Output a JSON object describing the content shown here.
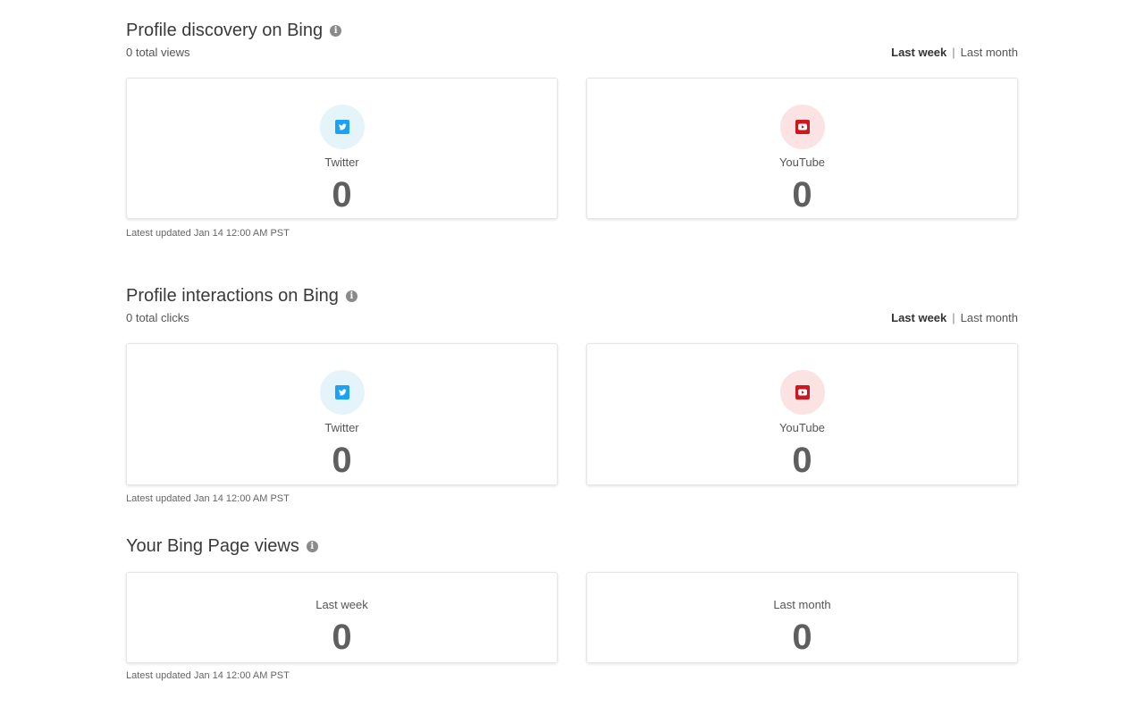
{
  "sections": [
    {
      "title": "Profile discovery on Bing",
      "info_icon": "info-icon",
      "subtitle": "0 total views",
      "toggle": {
        "active": "Last week",
        "separator": "|",
        "inactive": "Last month"
      },
      "cards": [
        {
          "platform": "Twitter",
          "icon": "twitter-icon",
          "count": "0"
        },
        {
          "platform": "YouTube",
          "icon": "youtube-icon",
          "count": "0"
        }
      ],
      "updated": "Latest updated Jan 14 12:00 AM PST"
    },
    {
      "title": "Profile interactions on Bing",
      "info_icon": "info-icon",
      "subtitle": "0 total clicks",
      "toggle": {
        "active": "Last week",
        "separator": "|",
        "inactive": "Last month"
      },
      "cards": [
        {
          "platform": "Twitter",
          "icon": "twitter-icon",
          "count": "0"
        },
        {
          "platform": "YouTube",
          "icon": "youtube-icon",
          "count": "0"
        }
      ],
      "updated": "Latest updated Jan 14 12:00 AM PST"
    },
    {
      "title": "Your Bing Page views",
      "info_icon": "info-icon",
      "cards": [
        {
          "label": "Last week",
          "count": "0"
        },
        {
          "label": "Last month",
          "count": "0"
        }
      ],
      "updated": "Latest updated Jan 14 12:00 AM PST"
    }
  ],
  "colors": {
    "twitter": "#1da1f2",
    "twitter_bg": "#e5f4fb",
    "youtube": "#cc181e",
    "youtube_bg": "#fbe3e3",
    "count_text": "#5f5f5f"
  }
}
